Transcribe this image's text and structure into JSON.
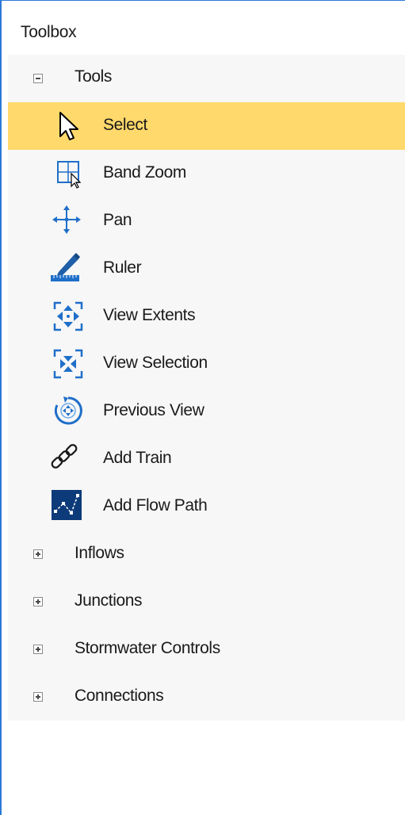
{
  "panel": {
    "title": "Toolbox"
  },
  "tools_group": {
    "label": "Tools",
    "expanded": true,
    "items": [
      {
        "label": "Select",
        "icon": "cursor-arrow-icon",
        "selected": true
      },
      {
        "label": "Band Zoom",
        "icon": "band-zoom-icon"
      },
      {
        "label": "Pan",
        "icon": "pan-icon"
      },
      {
        "label": "Ruler",
        "icon": "ruler-icon"
      },
      {
        "label": "View Extents",
        "icon": "view-extents-icon"
      },
      {
        "label": "View Selection",
        "icon": "view-selection-icon"
      },
      {
        "label": "Previous View",
        "icon": "previous-view-icon"
      },
      {
        "label": "Add Train",
        "icon": "chain-link-icon"
      },
      {
        "label": "Add Flow Path",
        "icon": "flow-path-icon"
      }
    ]
  },
  "collapsed_groups": [
    {
      "label": "Inflows"
    },
    {
      "label": "Junctions"
    },
    {
      "label": "Stormwater Controls"
    },
    {
      "label": "Connections"
    }
  ],
  "colors": {
    "selection": "#ffd96b",
    "accent_blue": "#1f6fc9",
    "border": "#2b78d6"
  }
}
